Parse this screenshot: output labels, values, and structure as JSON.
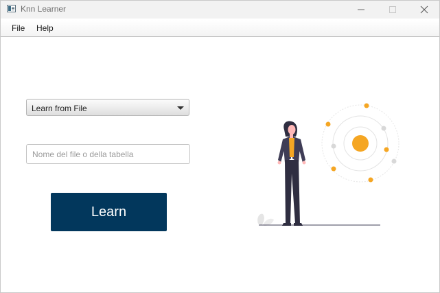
{
  "window": {
    "title": "Knn Learner"
  },
  "menu": {
    "items": [
      {
        "label": "File"
      },
      {
        "label": "Help"
      }
    ]
  },
  "form": {
    "mode_select": {
      "selected": "Learn from File"
    },
    "filename_input": {
      "value": "",
      "placeholder": "Nome del file o della tabella"
    },
    "learn_button": {
      "label": "Learn"
    }
  },
  "colors": {
    "button_bg": "#02375c",
    "accent": "#f5a623",
    "figure_dark": "#2f2e41"
  },
  "icons": {
    "app": "app-window-icon",
    "minimize": "minimize-icon",
    "maximize": "maximize-icon",
    "close": "close-icon",
    "dropdown": "chevron-down-icon"
  }
}
